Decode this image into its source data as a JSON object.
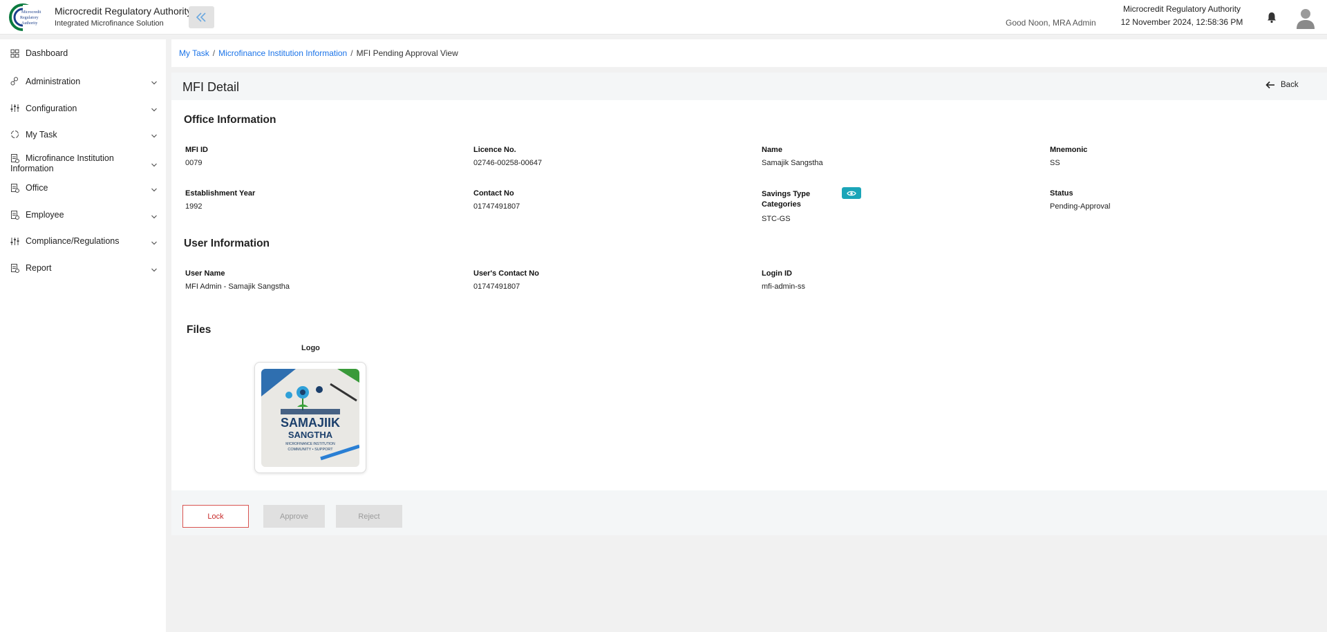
{
  "header": {
    "brand_title": "Microcredit Regulatory Authority",
    "brand_subtitle": "Integrated Microfinance Solution",
    "logo_text": [
      "Microcredit",
      "Regulatory",
      "Authority"
    ],
    "greeting": "Good Noon, MRA Admin",
    "org_name": "Microcredit Regulatory Authority",
    "datetime": "12 November 2024, 12:58:36 PM",
    "icons": [
      "double-chevron-left-icon",
      "bell-icon",
      "user-avatar-icon"
    ]
  },
  "sidebar": {
    "items": [
      {
        "label": "Dashboard",
        "icon": "grid-icon"
      },
      {
        "label": "Administration",
        "icon": "admin-icon"
      },
      {
        "label": "Configuration",
        "icon": "sliders-icon"
      },
      {
        "label": "My Task",
        "icon": "task-icon"
      },
      {
        "label": "Microfinance Institution Information",
        "icon": "document-icon"
      },
      {
        "label": "Office",
        "icon": "document-icon"
      },
      {
        "label": "Employee",
        "icon": "document-icon"
      },
      {
        "label": "Compliance/Regulations",
        "icon": "sliders-icon"
      },
      {
        "label": "Report",
        "icon": "document-icon"
      }
    ]
  },
  "breadcrumb": {
    "items": [
      "My Task",
      "Microfinance Institution Information"
    ],
    "current": "MFI Pending Approval View",
    "separator": "/"
  },
  "page": {
    "title": "MFI Detail",
    "back_label": "Back"
  },
  "office_info": {
    "title": "Office Information",
    "fields": [
      {
        "label": "MFI ID",
        "value": "0079"
      },
      {
        "label": "Licence No.",
        "value": "02746-00258-00647"
      },
      {
        "label": "Name",
        "value": "Samajik Sangstha"
      },
      {
        "label": "Mnemonic",
        "value": "SS"
      },
      {
        "label": "Establishment Year",
        "value": "1992"
      },
      {
        "label": "Contact No",
        "value": "01747491807"
      },
      {
        "label": "Savings Type Categories",
        "value": "STC-GS"
      },
      {
        "label": "Status",
        "value": "Pending-Approval"
      }
    ]
  },
  "user_info": {
    "title": "User Information",
    "fields": [
      {
        "label": "User Name",
        "value": "MFI Admin - Samajik Sangstha"
      },
      {
        "label": "User's Contact No",
        "value": "01747491807"
      },
      {
        "label": "Login ID",
        "value": "mfi-admin-ss"
      }
    ]
  },
  "files": {
    "title": "Files",
    "logo_label": "Logo",
    "logo_image_text": {
      "line1": "SAMAJIIK",
      "line2": "SANGTHA",
      "line3": "MICROFINANCE INSTITUTION",
      "line4": "COMMUNITY • SUPPORT"
    }
  },
  "actions": {
    "lock": "Lock",
    "approve": "Approve",
    "reject": "Reject"
  },
  "colors": {
    "link": "#1a73e8",
    "accent_teal": "#1ba5b8",
    "lock_red": "#c62828",
    "disabled_bg": "#e0e0e0"
  }
}
